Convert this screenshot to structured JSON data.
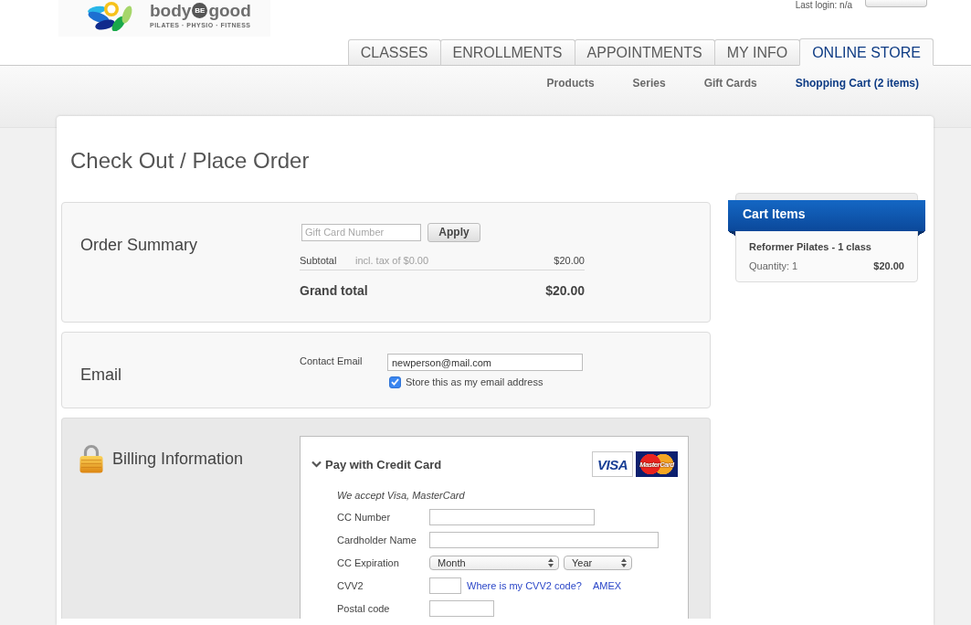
{
  "header": {
    "logo": {
      "wordmark": [
        "body",
        "BE",
        "good"
      ],
      "tagline": "PILATES · PHYSIO · FITNESS"
    },
    "last_login": "Last login: n/a"
  },
  "tabs": [
    {
      "label": "CLASSES",
      "selected": false
    },
    {
      "label": "ENROLLMENTS",
      "selected": false
    },
    {
      "label": "APPOINTMENTS",
      "selected": false
    },
    {
      "label": "MY INFO",
      "selected": false
    },
    {
      "label": "ONLINE STORE",
      "selected": true
    }
  ],
  "subnav": [
    {
      "label": "Products",
      "selected": false
    },
    {
      "label": "Series",
      "selected": false
    },
    {
      "label": "Gift Cards",
      "selected": false
    },
    {
      "label": "Shopping Cart (2 items)",
      "selected": true
    }
  ],
  "page_title": "Check Out / Place Order",
  "order_summary": {
    "heading": "Order Summary",
    "gift_card": {
      "placeholder": "Gift Card Number"
    },
    "apply_button": "Apply",
    "subtotal": {
      "label": "Subtotal",
      "note": "incl. tax of $0.00",
      "amount": "$20.00"
    },
    "grand_total": {
      "label": "Grand total",
      "amount": "$20.00"
    }
  },
  "email": {
    "heading": "Email",
    "field_label": "Contact Email",
    "value": "newperson@mail.com",
    "store": {
      "label": "Store this as my email address",
      "checked": true
    }
  },
  "billing": {
    "heading": "Billing Information",
    "method": {
      "label": "Pay with Credit Card",
      "expanded": true
    },
    "card_logos": [
      {
        "kind": "visa",
        "label": "VISA"
      },
      {
        "kind": "mastercard",
        "label": "MasterCard"
      }
    ],
    "accept_note": "We accept Visa, MasterCard",
    "fields": [
      {
        "kind": "number",
        "label": "CC Number"
      },
      {
        "kind": "name",
        "label": "Cardholder Name"
      },
      {
        "kind": "expiry",
        "label": "CC Expiration",
        "selects": [
          {
            "value": "Month"
          },
          {
            "value": "Year"
          }
        ]
      },
      {
        "kind": "cvv",
        "label": "CVV2",
        "links": [
          "Where is my CVV2 code?",
          "AMEX"
        ]
      },
      {
        "kind": "postal",
        "label": "Postal code"
      }
    ]
  },
  "cart": {
    "title": "Cart Items",
    "items": [
      {
        "name": "Reformer Pilates - 1 class",
        "quantity": "Quantity: 1",
        "price": "$20.00"
      }
    ]
  }
}
